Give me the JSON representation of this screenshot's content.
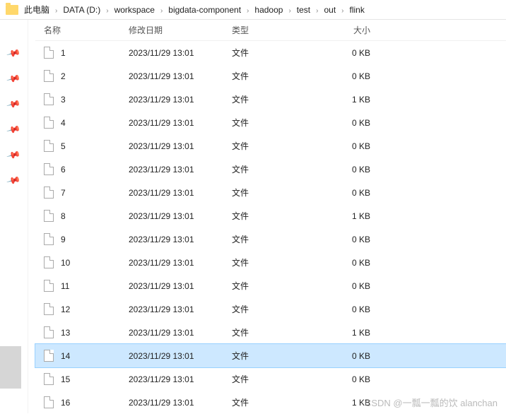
{
  "breadcrumb": [
    "此电脑",
    "DATA (D:)",
    "workspace",
    "bigdata-component",
    "hadoop",
    "test",
    "out",
    "flink"
  ],
  "columns": {
    "name": "名称",
    "date": "修改日期",
    "type": "类型",
    "size": "大小"
  },
  "files": [
    {
      "name": "1",
      "date": "2023/11/29 13:01",
      "type": "文件",
      "size": "0 KB"
    },
    {
      "name": "2",
      "date": "2023/11/29 13:01",
      "type": "文件",
      "size": "0 KB"
    },
    {
      "name": "3",
      "date": "2023/11/29 13:01",
      "type": "文件",
      "size": "1 KB"
    },
    {
      "name": "4",
      "date": "2023/11/29 13:01",
      "type": "文件",
      "size": "0 KB"
    },
    {
      "name": "5",
      "date": "2023/11/29 13:01",
      "type": "文件",
      "size": "0 KB"
    },
    {
      "name": "6",
      "date": "2023/11/29 13:01",
      "type": "文件",
      "size": "0 KB"
    },
    {
      "name": "7",
      "date": "2023/11/29 13:01",
      "type": "文件",
      "size": "0 KB"
    },
    {
      "name": "8",
      "date": "2023/11/29 13:01",
      "type": "文件",
      "size": "1 KB"
    },
    {
      "name": "9",
      "date": "2023/11/29 13:01",
      "type": "文件",
      "size": "0 KB"
    },
    {
      "name": "10",
      "date": "2023/11/29 13:01",
      "type": "文件",
      "size": "0 KB"
    },
    {
      "name": "11",
      "date": "2023/11/29 13:01",
      "type": "文件",
      "size": "0 KB"
    },
    {
      "name": "12",
      "date": "2023/11/29 13:01",
      "type": "文件",
      "size": "0 KB"
    },
    {
      "name": "13",
      "date": "2023/11/29 13:01",
      "type": "文件",
      "size": "1 KB"
    },
    {
      "name": "14",
      "date": "2023/11/29 13:01",
      "type": "文件",
      "size": "0 KB"
    },
    {
      "name": "15",
      "date": "2023/11/29 13:01",
      "type": "文件",
      "size": "0 KB"
    },
    {
      "name": "16",
      "date": "2023/11/29 13:01",
      "type": "文件",
      "size": "1 KB"
    }
  ],
  "selected_index": 13,
  "watermark": "CSDN @一瓢一瓢的饮 alanchan"
}
